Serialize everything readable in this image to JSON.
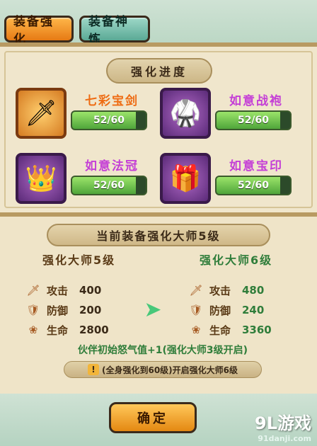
{
  "tabs": {
    "enhance": "装备强化",
    "refine": "装备神炼"
  },
  "progress": {
    "title": "强化进度",
    "items": [
      {
        "name": "七彩宝剑",
        "progress": "52/60",
        "fraction": 0.8667,
        "icon": "sword-icon"
      },
      {
        "name": "如意战袍",
        "progress": "52/60",
        "fraction": 0.8667,
        "icon": "armor-icon"
      },
      {
        "name": "如意法冠",
        "progress": "52/60",
        "fraction": 0.8667,
        "icon": "crown-icon"
      },
      {
        "name": "如意宝印",
        "progress": "52/60",
        "fraction": 0.8667,
        "icon": "seal-icon"
      }
    ]
  },
  "master": {
    "title": "当前装备强化大师5级",
    "current": {
      "level": "强化大师5级",
      "stats": [
        {
          "label": "攻击",
          "value": "400"
        },
        {
          "label": "防御",
          "value": "200"
        },
        {
          "label": "生命",
          "value": "2800"
        }
      ]
    },
    "next": {
      "level": "强化大师6级",
      "stats": [
        {
          "label": "攻击",
          "value": "480"
        },
        {
          "label": "防御",
          "value": "240"
        },
        {
          "label": "生命",
          "value": "3360"
        }
      ]
    },
    "note": "伙伴初始怒气值+1(强化大师3级开启)",
    "unlock": "(全身强化到60级)开启强化大师6级"
  },
  "confirm": "确定",
  "watermark": {
    "brand": "9L游戏",
    "url": "91danji.com"
  },
  "colors": {
    "accent": "#e67a14",
    "next": "#2f7d3a",
    "purple": "#c43fd6"
  }
}
